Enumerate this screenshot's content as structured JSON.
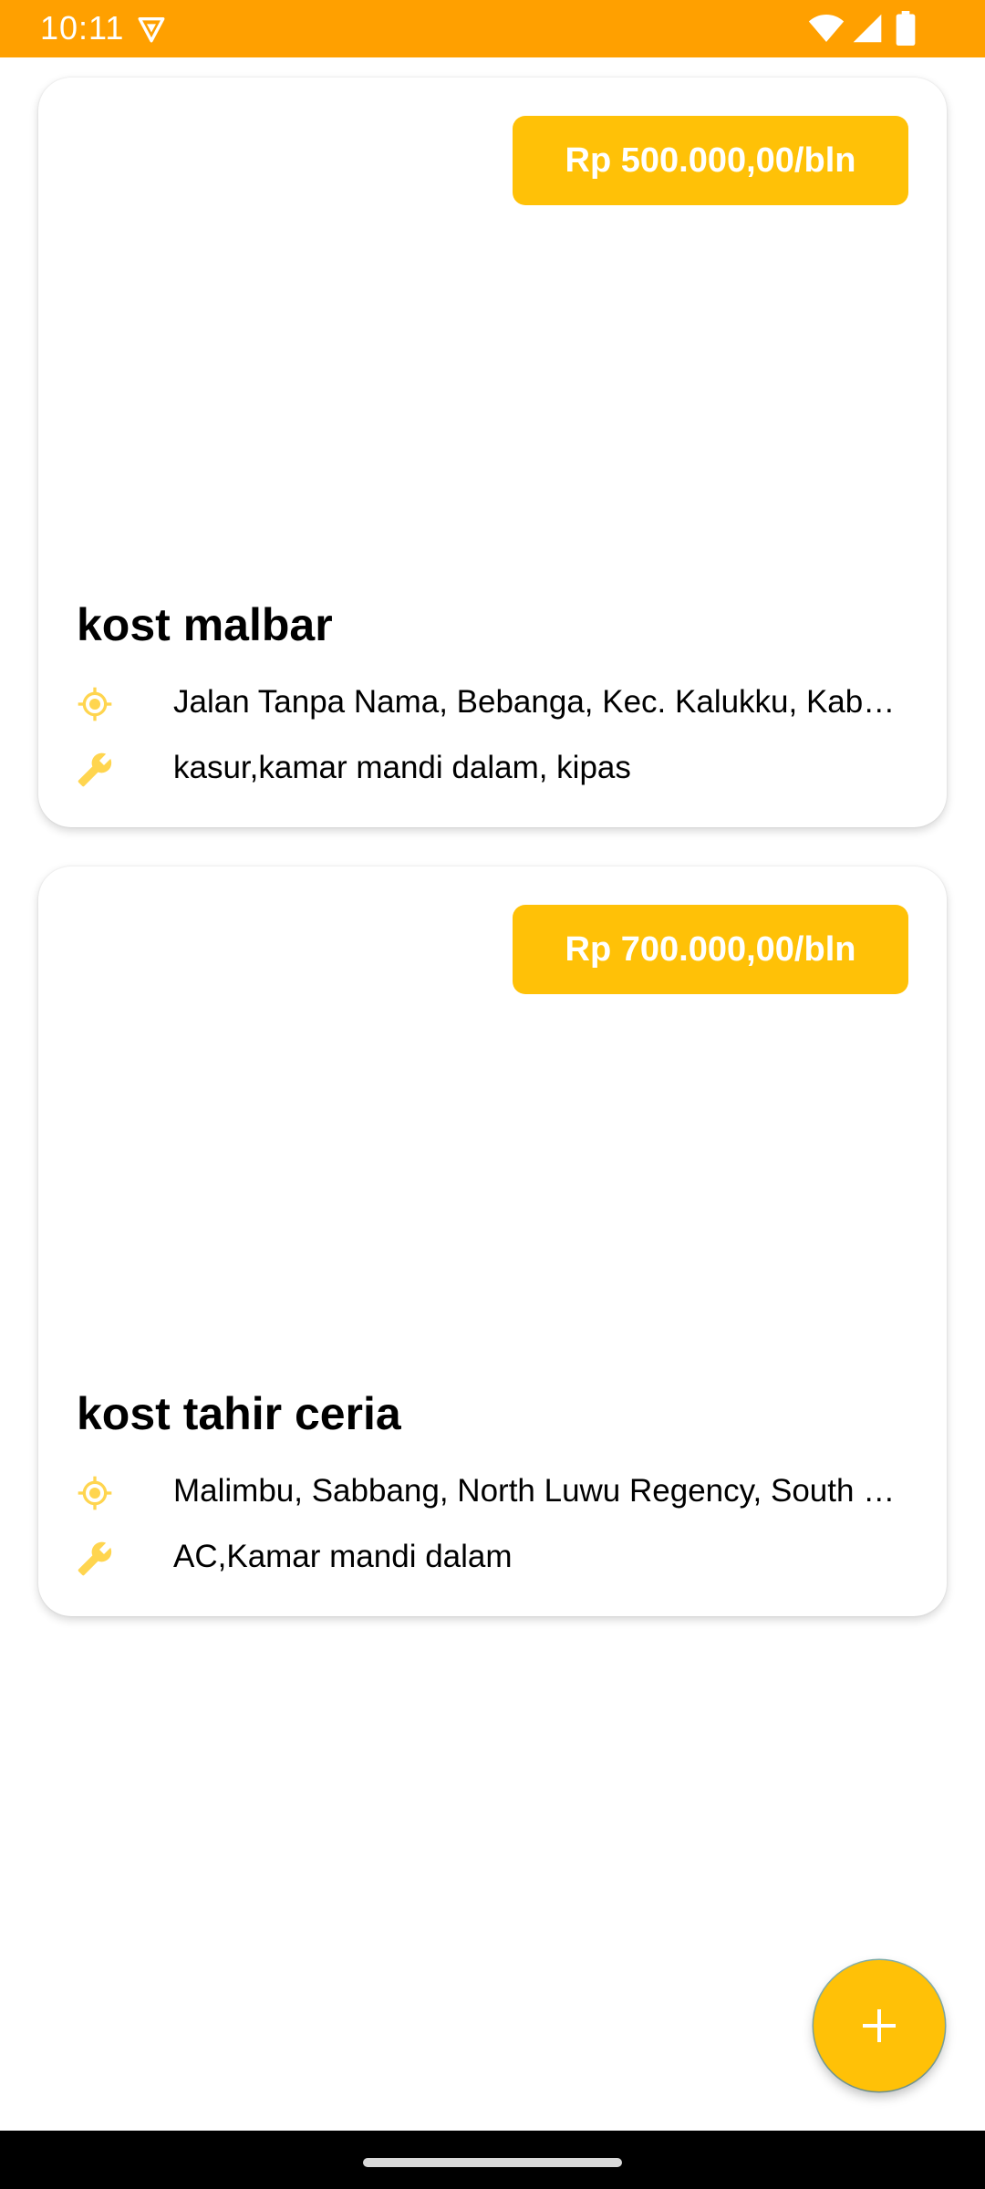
{
  "status_bar": {
    "time": "10:11",
    "background_color": "#FFA000",
    "icons": [
      "vpn-shield-icon",
      "wifi-icon",
      "signal-icon",
      "battery-icon"
    ]
  },
  "listings": [
    {
      "price": "Rp 500.000,00/bln",
      "name": "kost malbar",
      "address": "Jalan Tanpa Nama, Bebanga, Kec. Kalukku, Kabupaten Mamuju, Sulawesi Barat",
      "facilities": "kasur,kamar mandi dalam, kipas"
    },
    {
      "price": "Rp 700.000,00/bln",
      "name": "kost tahir ceria",
      "address": "Malimbu, Sabbang, North Luwu Regency, South Sulawesi",
      "facilities": "AC,Kamar mandi dalam"
    }
  ],
  "icons": {
    "address": "location-target-icon",
    "facilities": "wrench-icon",
    "fab": "plus-icon"
  },
  "colors": {
    "accent": "#FFC107",
    "icon_tint": "#FFD54F"
  }
}
